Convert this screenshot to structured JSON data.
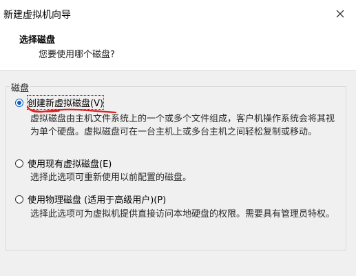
{
  "window": {
    "title": "新建虚拟机向导",
    "close_icon": "close-icon"
  },
  "header": {
    "title": "选择磁盘",
    "subtitle": "您要使用哪个磁盘?"
  },
  "disk_group": {
    "label": "磁盘",
    "options": [
      {
        "label": "创建新虚拟磁盘(V)",
        "checked": true,
        "description": "虚拟磁盘由主机文件系统上的一个或多个文件组成，客户机操作系统会将其视为单个硬盘。虚拟磁盘可在一台主机上或多台主机之间轻松复制或移动。"
      },
      {
        "label": "使用现有虚拟磁盘(E)",
        "checked": false,
        "description": "选择此选项可重新使用以前配置的磁盘。"
      },
      {
        "label": "使用物理磁盘 (适用于高级用户)(P)",
        "checked": false,
        "description": "选择此选项可为虚拟机提供直接访问本地硬盘的权限。需要具有管理员特权。"
      }
    ]
  },
  "colors": {
    "accent": "#0a5ec5",
    "annotation": "#e02020"
  }
}
